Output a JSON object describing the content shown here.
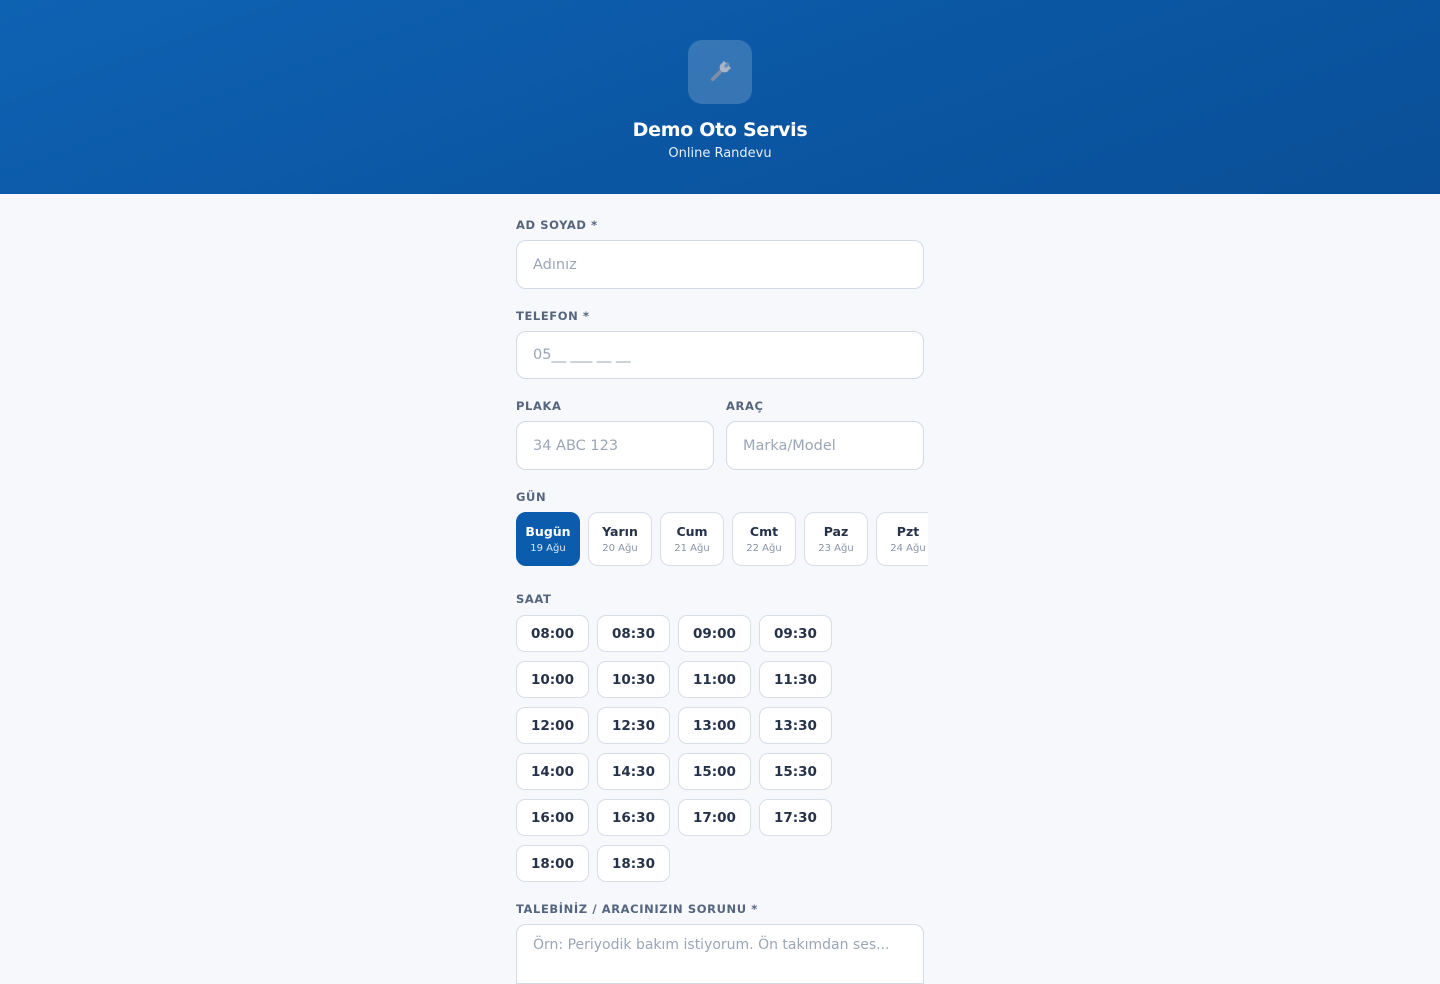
{
  "header": {
    "logo_icon": "wrench-icon",
    "title": "Demo Oto Servis",
    "subtitle": "Online Randevu"
  },
  "form": {
    "name": {
      "label": "AD SOYAD *",
      "placeholder": "Adınız",
      "value": ""
    },
    "phone": {
      "label": "TELEFON *",
      "placeholder": "05__ ___ __ __",
      "value": ""
    },
    "plate": {
      "label": "PLAKA",
      "placeholder": "34 ABC 123",
      "value": ""
    },
    "vehicle": {
      "label": "ARAÇ",
      "placeholder": "Marka/Model",
      "value": ""
    },
    "day": {
      "label": "GÜN",
      "options": [
        {
          "name": "Bugün",
          "date": "19 Ağu",
          "selected": true
        },
        {
          "name": "Yarın",
          "date": "20 Ağu",
          "selected": false
        },
        {
          "name": "Cum",
          "date": "21 Ağu",
          "selected": false
        },
        {
          "name": "Cmt",
          "date": "22 Ağu",
          "selected": false
        },
        {
          "name": "Paz",
          "date": "23 Ağu",
          "selected": false
        },
        {
          "name": "Pzt",
          "date": "24 Ağu",
          "selected": false
        }
      ]
    },
    "time": {
      "label": "SAAT",
      "slots": [
        "08:00",
        "08:30",
        "09:00",
        "09:30",
        "10:00",
        "10:30",
        "11:00",
        "11:30",
        "12:00",
        "12:30",
        "13:00",
        "13:30",
        "14:00",
        "14:30",
        "15:00",
        "15:30",
        "16:00",
        "16:30",
        "17:00",
        "17:30",
        "18:00",
        "18:30"
      ]
    },
    "request": {
      "label": "TALEBİNİZ / ARACINIZIN SORUNU *",
      "placeholder": "Örn: Periyodik bakım istiyorum. Ön takımdan ses..."
    }
  },
  "colors": {
    "primary": "#0b5cad",
    "header_gradient_start": "#0e62b3",
    "header_gradient_end": "#0a4f97",
    "background": "#f6f8fb"
  }
}
